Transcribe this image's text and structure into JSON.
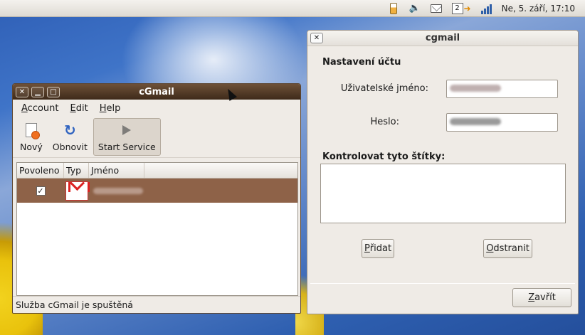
{
  "top_panel": {
    "tray_icons": [
      "battery-icon",
      "volume-icon",
      "mail-icon",
      "notification-icon",
      "network-signal-icon"
    ],
    "notification_count": "2",
    "clock": "Ne,  5. září, 17:10"
  },
  "main_window": {
    "title": "cGmail",
    "menu": [
      {
        "label": "Account",
        "mnemonic": "A",
        "rest": "ccount"
      },
      {
        "label": "Edit",
        "mnemonic": "E",
        "rest": "dit"
      },
      {
        "label": "Help",
        "mnemonic": "H",
        "rest": "elp"
      }
    ],
    "toolbar": {
      "new_label": "Nový",
      "refresh_label": "Obnovit",
      "start_label": "Start Service"
    },
    "list": {
      "columns": [
        "Povoleno",
        "Typ",
        "Jméno"
      ],
      "rows": [
        {
          "enabled": true,
          "type_icon": "gmail-icon",
          "name": ""
        }
      ]
    },
    "status": "Služba cGmail je spuštěná"
  },
  "settings_window": {
    "title": "cgmail",
    "section_title": "Nastavení účtu",
    "username_label": "Uživatelské jméno:",
    "password_label": "Heslo:",
    "labels_title": "Kontrolovat tyto štítky:",
    "add_button": {
      "mnemonic": "P",
      "rest": "řidat"
    },
    "remove_button": {
      "mnemonic": "O",
      "rest": "dstranit"
    },
    "close_button": {
      "mnemonic": "Z",
      "rest": "avřít"
    }
  }
}
